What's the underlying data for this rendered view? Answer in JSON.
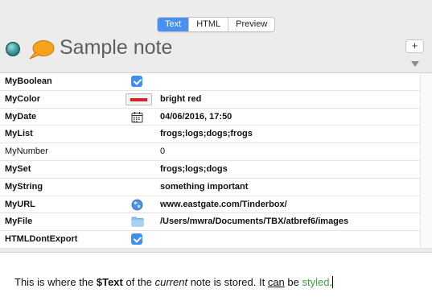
{
  "tabs": [
    {
      "label": "Text",
      "active": true
    },
    {
      "label": "HTML",
      "active": false
    },
    {
      "label": "Preview",
      "active": false
    }
  ],
  "header": {
    "title": "Sample note",
    "add_label": "+",
    "badge_icon": "teal-orb-icon",
    "note_icon": "speech-bubble-icon",
    "menu_icon": "triangle-down-icon"
  },
  "attributes": [
    {
      "name": "MyBoolean",
      "icon": "checkbox-checked",
      "value": ""
    },
    {
      "name": "MyColor",
      "icon": "color-swatch",
      "value": "bright red",
      "swatch_color": "#d6232a"
    },
    {
      "name": "MyDate",
      "icon": "calendar-icon",
      "value": "04/06/2016, 17:50"
    },
    {
      "name": "MyList",
      "icon": "",
      "value": "frogs;logs;dogs;frogs"
    },
    {
      "name": "MyNumber",
      "icon": "",
      "value": "0"
    },
    {
      "name": "MySet",
      "icon": "",
      "value": "frogs;logs;dogs"
    },
    {
      "name": "MyString",
      "icon": "",
      "value": "something important"
    },
    {
      "name": "MyURL",
      "icon": "globe-icon",
      "value": "www.eastgate.com/Tinderbox/"
    },
    {
      "name": "MyFile",
      "icon": "folder-icon",
      "value": "/Users/mwra/Documents/TBX/atbref6/images"
    },
    {
      "name": "HTMLDontExport",
      "icon": "checkbox-checked",
      "value": ""
    }
  ],
  "text": {
    "p1": "This is where the ",
    "p2": "$Text",
    "p3": " of the ",
    "p4": "current",
    "p5": " note is stored. It ",
    "p6": "can",
    "p7": " be ",
    "p8": "styled",
    "p9": "."
  },
  "colors": {
    "accent": "#4a90f0",
    "checkbox": "#3d8ef5",
    "styled_text": "#3aa53a",
    "title": "#5e5e5e"
  }
}
